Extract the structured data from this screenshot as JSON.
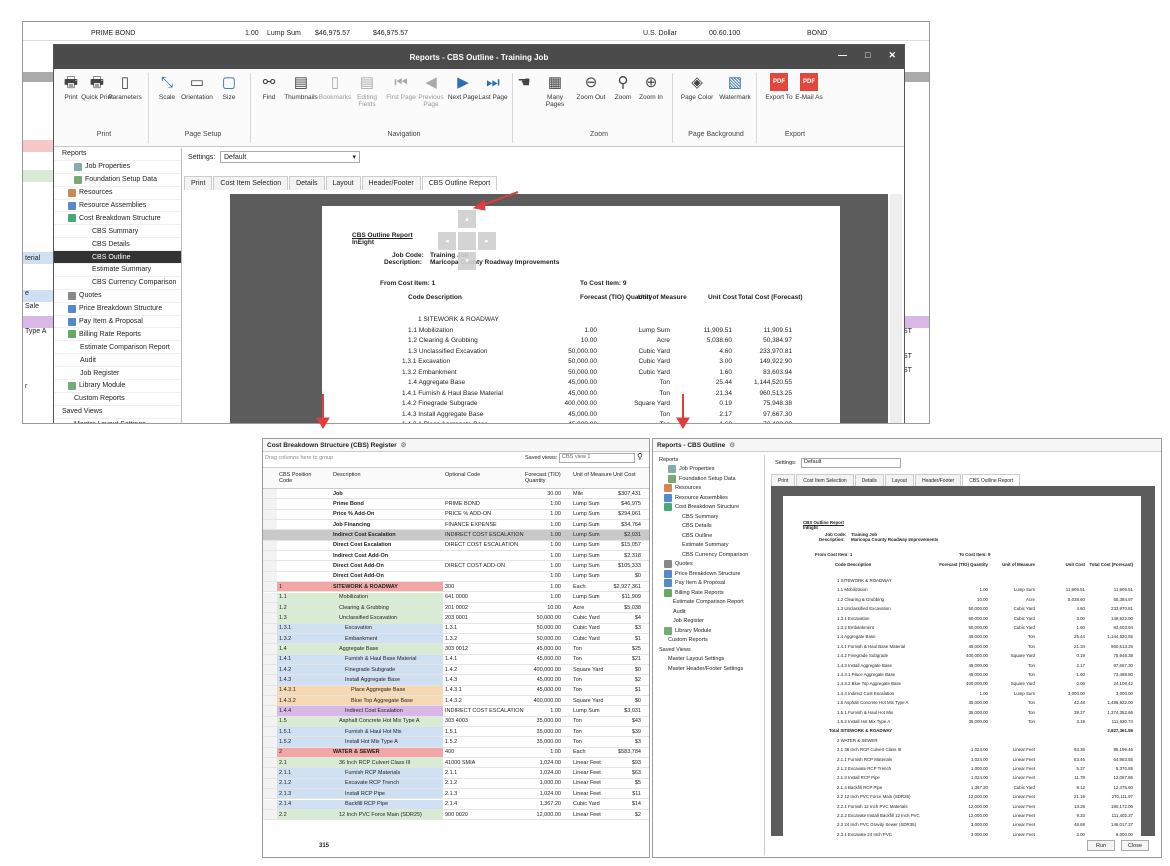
{
  "bg_rows": [
    {
      "a": "PRIME BOND",
      "b": "1.00",
      "c": "Lump Sum",
      "d": "$46,975.57",
      "e": "$46,975.57",
      "f": "U.S. Dollar",
      "g": "00.60.100",
      "h": "BOND"
    }
  ],
  "bg_side": [
    "terial",
    "e",
    "Sale",
    "Type A",
    "r"
  ],
  "bg_right": [
    "ST",
    "ST",
    "ST"
  ],
  "modal": {
    "title": "Reports - CBS Outline - Training Job",
    "controls": [
      "—",
      "□",
      "✕"
    ],
    "ribbon": {
      "buttons": [
        "Print",
        "Quick Print",
        "Parameters",
        "Scale",
        "Orientation",
        "Size",
        "Find",
        "Thumbnails",
        "Bookmarks",
        "Editing Fields",
        "First Page",
        "Previous Page",
        "Next Page",
        "Last Page",
        "Many Pages",
        "Zoom Out",
        "Zoom",
        "Zoom In",
        "Page Color",
        "Watermark",
        "Export To",
        "E-Mail As"
      ],
      "groups": [
        "Print",
        "Page Setup",
        "Navigation",
        "Zoom",
        "Page Background",
        "Export"
      ]
    },
    "tree": [
      "Reports",
      "Job Properties",
      "Foundation Setup Data",
      "Resources",
      "Resource Assemblies",
      "Cost Breakdown Structure",
      "CBS Summary",
      "CBS Details",
      "CBS Outline",
      "Estimate Summary",
      "CBS Currency Comparison",
      "Quotes",
      "Price Breakdown Structure",
      "Pay Item & Proposal",
      "Billing Rate Reports",
      "Estimate Comparison Report",
      "Audit",
      "Job Register",
      "Library Module",
      "Custom Reports",
      "Saved Views",
      "Master Layout Settings",
      "Master Header/Footer Settings"
    ],
    "settings_label": "Settings:",
    "settings_value": "Default",
    "tabs": [
      "Print",
      "Cost Item Selection",
      "Details",
      "Layout",
      "Header/Footer",
      "CBS Outline Report"
    ]
  },
  "report": {
    "title": "CBS Outline Report",
    "company": "InEight",
    "job_code_label": "Job Code:",
    "job_code": "Training Job",
    "desc_label": "Description:",
    "desc": "Maricopa County Roadway Improvements",
    "from_label": "From Cost Item: 1",
    "to_label": "To Cost Item: 9",
    "headers": [
      "Code Description",
      "Forecast (TIO) Quantity",
      "Unit of Measure",
      "Unit Cost",
      "Total Cost (Forecast)"
    ],
    "rows": [
      [
        "1 SITEWORK & ROADWAY",
        "",
        "",
        "",
        ""
      ],
      [
        "1.1 Mobilization",
        "1.00",
        "Lump Sum",
        "11,909.51",
        "11,909.51"
      ],
      [
        "1.2 Clearing & Grubbing",
        "10.00",
        "Acre",
        "5,038.60",
        "50,384.97"
      ],
      [
        "1.3 Unclassified Excavation",
        "50,000.00",
        "Cubic Yard",
        "4.60",
        "233,970.81"
      ],
      [
        "1.3.1 Excavation",
        "50,000.00",
        "Cubic Yard",
        "3.00",
        "149,922.90"
      ],
      [
        "1.3.2 Embankment",
        "50,000.00",
        "Cubic Yard",
        "1.60",
        "83,603.94"
      ],
      [
        "1.4 Aggregate Base",
        "45,000.00",
        "Ton",
        "25.44",
        "1,144,520.55"
      ],
      [
        "1.4.1 Furnish & Haul Base Material",
        "45,000.00",
        "Ton",
        "21.34",
        "960,513.25"
      ],
      [
        "1.4.2 Finegrade Subgrade",
        "400,000.00",
        "Square Yard",
        "0.19",
        "75,948.38"
      ],
      [
        "1.4.3 Install Aggregate Base",
        "45,000.00",
        "Ton",
        "2.17",
        "97,667.30"
      ],
      [
        "1.4.3.1 Place Aggregate Base",
        "45,000.00",
        "Ton",
        "1.60",
        "73,488.80"
      ],
      [
        "1.4.3.2 Blue Top Aggregate Base",
        "400,000.00",
        "Square Yard",
        "0.06",
        "24,108.42"
      ]
    ]
  },
  "register": {
    "title": "Cost Breakdown Structure (CBS) Register",
    "group_hint": "Drag columns here to group",
    "saved_views_label": "Saved views:",
    "saved_views_value": "CBS view 1",
    "headers": [
      "CBS Position Code",
      "Description",
      "Optional Code",
      "Forecast (TIO) Quantity",
      "Unit of Measure",
      "Unit Cost"
    ],
    "rows": [
      [
        "",
        "Job",
        "",
        "30.00",
        "Mile",
        "$307,431"
      ],
      [
        "",
        "Prime Bond",
        "PRIME BOND",
        "1.00",
        "Lump Sum",
        "$46,975"
      ],
      [
        "",
        "Price % Add-On",
        "PRICE % ADD-ON",
        "1.00",
        "Lump Sum",
        "$294,061"
      ],
      [
        "",
        "Job Financing",
        "FINANCE EXPENSE",
        "1.00",
        "Lump Sum",
        "$34,764"
      ],
      [
        "",
        "Indirect Cost Escalation",
        "INDIRECT COST ESCALATION",
        "1.00",
        "Lump Sum",
        "$2,031"
      ],
      [
        "",
        "Direct Cost Escalation",
        "DIRECT COST ESCALATION",
        "1.00",
        "Lump Sum",
        "$15,057"
      ],
      [
        "",
        "Indirect Cost Add-On",
        "",
        "1.00",
        "Lump Sum",
        "$2,318"
      ],
      [
        "",
        "Direct Cost Add-On",
        "DIRECT COST ADD-ON",
        "1.00",
        "Lump Sum",
        "$105,333"
      ],
      [
        "",
        "Direct Cost Add-On",
        "",
        "1.00",
        "Lump Sum",
        "$0"
      ],
      [
        "1",
        "SITEWORK & ROADWAY",
        "300",
        "1.00",
        "Each",
        "$2,927,361"
      ],
      [
        "1.1",
        "Mobilization",
        "641 0000",
        "1.00",
        "Lump Sum",
        "$11,909"
      ],
      [
        "1.2",
        "Clearing & Grubbing",
        "201 0002",
        "10.00",
        "Acre",
        "$5,038"
      ],
      [
        "1.3",
        "Unclassified Excavation",
        "203 0001",
        "50,000.00",
        "Cubic Yard",
        "$4"
      ],
      [
        "1.3.1",
        "Excavation",
        "1.3.1",
        "50,000.00",
        "Cubic Yard",
        "$3"
      ],
      [
        "1.3.2",
        "Embankment",
        "1.3.2",
        "50,000.00",
        "Cubic Yard",
        "$1"
      ],
      [
        "1.4",
        "Aggregate Base",
        "303 0012",
        "45,000.00",
        "Ton",
        "$25"
      ],
      [
        "1.4.1",
        "Furnish & Haul Base Material",
        "1.4.1",
        "45,000.00",
        "Ton",
        "$21"
      ],
      [
        "1.4.2",
        "Finegrade Subgrade",
        "1.4.2",
        "400,000.00",
        "Square Yard",
        "$0"
      ],
      [
        "1.4.3",
        "Install Aggregate Base",
        "1.4.3",
        "45,000.00",
        "Ton",
        "$2"
      ],
      [
        "1.4.3.1",
        "Place Aggregate Base",
        "1.4.3.1",
        "45,000.00",
        "Ton",
        "$1"
      ],
      [
        "1.4.3.2",
        "Blue Top Aggregate Base",
        "1.4.3.2",
        "400,000.00",
        "Square Yard",
        "$0"
      ],
      [
        "1.4.4",
        "Indirect Cost Escalation",
        "INDIRECT COST ESCALATION",
        "1.00",
        "Lump Sum",
        "$3,031"
      ],
      [
        "1.5",
        "Asphalt Concrete Hot Mix Type A",
        "303 4003",
        "35,000.00",
        "Ton",
        "$43"
      ],
      [
        "1.5.1",
        "Furnish & Haul Hot Mix",
        "1.5.1",
        "35,000.00",
        "Ton",
        "$39"
      ],
      [
        "1.5.2",
        "Install Hot Mix Type A",
        "1.5.2",
        "35,000.00",
        "Ton",
        "$3"
      ],
      [
        "2",
        "WATER & SEWER",
        "400",
        "1.00",
        "Each",
        "$583,784"
      ],
      [
        "2.1",
        "36 Inch RCP Culvert Class III",
        "41000 SMIA",
        "1,024.00",
        "Linear Feet",
        "$93"
      ],
      [
        "2.1.1",
        "Furnish RCP Materials",
        "2.1.1",
        "1,024.00",
        "Linear Feet",
        "$63"
      ],
      [
        "2.1.2",
        "Excavate RCP Trench",
        "2.1.2",
        "1,000.00",
        "Linear Feet",
        "$5"
      ],
      [
        "2.1.3",
        "Install RCP Pipe",
        "2.1.3",
        "1,024.00",
        "Linear Feet",
        "$11"
      ],
      [
        "2.1.4",
        "Backfill RCP Pipe",
        "2.1.4",
        "1,367.20",
        "Cubic Yard",
        "$14"
      ],
      [
        "2.2",
        "12 Inch PVC Force Main (SDR25)",
        "900 0020",
        "12,000.00",
        "Linear Feet",
        "$2"
      ]
    ],
    "footer_count": "315"
  },
  "small": {
    "title": "Reports - CBS Outline",
    "tree": [
      "Reports",
      "Job Properties",
      "Foundation Setup Data",
      "Resources",
      "Resource Assemblies",
      "Cost Breakdown Structure",
      "CBS Summary",
      "CBS Details",
      "CBS Outline",
      "Estimate Summary",
      "CBS Currency Comparison",
      "Quotes",
      "Price Breakdown Structure",
      "Pay Item & Proposal",
      "Billing Rate Reports",
      "Estimate Comparison Report",
      "Audit",
      "Job Register",
      "Library Module",
      "Custom Reports",
      "Saved Views",
      "Master Layout Settings",
      "Master Header/Footer Settings"
    ],
    "settings_label": "Settings:",
    "settings_value": "Default",
    "tabs": [
      "Print",
      "Cost Item Selection",
      "Details",
      "Layout",
      "Header/Footer",
      "CBS Outline Report"
    ],
    "buttons": [
      "Run",
      "Close"
    ],
    "report_rows": [
      [
        "1 SITEWORK & ROADWAY",
        "",
        "",
        "",
        ""
      ],
      [
        "1.1 Mobilization",
        "1.00",
        "Lump Sum",
        "11,909.51",
        "11,909.51"
      ],
      [
        "1.2 Clearing & Grubbing",
        "10.00",
        "Acre",
        "5,038.60",
        "50,384.97"
      ],
      [
        "1.3 Unclassified Excavation",
        "50,000.00",
        "Cubic Yard",
        "4.60",
        "233,970.81"
      ],
      [
        "1.3.1 Excavation",
        "50,000.00",
        "Cubic Yard",
        "3.00",
        "149,922.90"
      ],
      [
        "1.3.2 Embankment",
        "50,000.00",
        "Cubic Yard",
        "1.60",
        "83,603.94"
      ],
      [
        "1.4 Aggregate Base",
        "45,000.00",
        "Ton",
        "25.44",
        "1,144,520.55"
      ],
      [
        "1.4.1 Furnish & Haul Base Material",
        "45,000.00",
        "Ton",
        "21.34",
        "960,513.25"
      ],
      [
        "1.4.2 Finegrade Subgrade",
        "400,000.00",
        "Square Yard",
        "0.19",
        "75,948.38"
      ],
      [
        "1.4.3 Install Aggregate Base",
        "45,000.00",
        "Ton",
        "2.17",
        "97,667.30"
      ],
      [
        "1.4.3.1 Place Aggregate Base",
        "45,000.00",
        "Ton",
        "1.60",
        "73,488.80"
      ],
      [
        "1.4.3.2 Blue Top Aggregate Base",
        "400,000.00",
        "Square Yard",
        "0.06",
        "24,108.42"
      ],
      [
        "1.4.4 Indirect Cost Escalation",
        "1.00",
        "Lump Sum",
        "3,000.00",
        "3,000.00"
      ],
      [
        "1.5 Asphalt Concrete Hot Mix Type A",
        "35,000.00",
        "Ton",
        "42.48",
        "1,486,922.00"
      ],
      [
        "1.5.1 Furnish & Haul Hot Mix",
        "35,000.00",
        "Ton",
        "39.27",
        "1,374,352.66"
      ],
      [
        "1.5.2 Install Hot Mix Type A",
        "35,000.00",
        "Ton",
        "3.19",
        "111,630.74"
      ],
      [
        "Total SITEWORK & ROADWAY",
        "",
        "",
        "",
        "2,927,361.56"
      ],
      [
        "2 WATER & SEWER",
        "",
        "",
        "",
        ""
      ],
      [
        "2.1 36 Inch RCP Culvert Class III",
        "1,024.00",
        "Linear Feet",
        "93.36",
        "95,199.46"
      ],
      [
        "2.1.1 Furnish RCP Materials",
        "1,024.00",
        "Linear Feet",
        "63.46",
        "64,983.55"
      ],
      [
        "2.1.2 Excavate RCP Trench",
        "1,000.00",
        "Linear Feet",
        "5.37",
        "5,370.85"
      ],
      [
        "2.1.3 Install RCP Pipe",
        "1,024.00",
        "Linear Feet",
        "11.78",
        "12,067.86"
      ],
      [
        "2.1.4 Backfill RCP Pipe",
        "1,367.20",
        "Cubic Yard",
        "9.12",
        "12,475.60"
      ],
      [
        "2.2 12 Inch PVC Force Main (SDR25)",
        "12,000.00",
        "Linear Feet",
        "21.19",
        "270,111.97"
      ],
      [
        "2.2.1 Furnish 12 Inch PVC Materials",
        "12,000.00",
        "Linear Feet",
        "13.28",
        "180,172.06"
      ],
      [
        "2.2.2 Excavate Install Backfill 12 Inch PVC",
        "12,000.00",
        "Linear Feet",
        "9.33",
        "111,402.37"
      ],
      [
        "2.3 24 Inch PVC Gravity Sewer (SDR35)",
        "3,000.00",
        "Linear Feet",
        "48.69",
        "146,017.37"
      ],
      [
        "2.3.1 Excavate 24 Inch PVC",
        "3,000.00",
        "Linear Feet",
        "2.00",
        "6,000.00"
      ]
    ]
  },
  "colors": {
    "accent": "#e33c3c",
    "selected": "#333333"
  }
}
